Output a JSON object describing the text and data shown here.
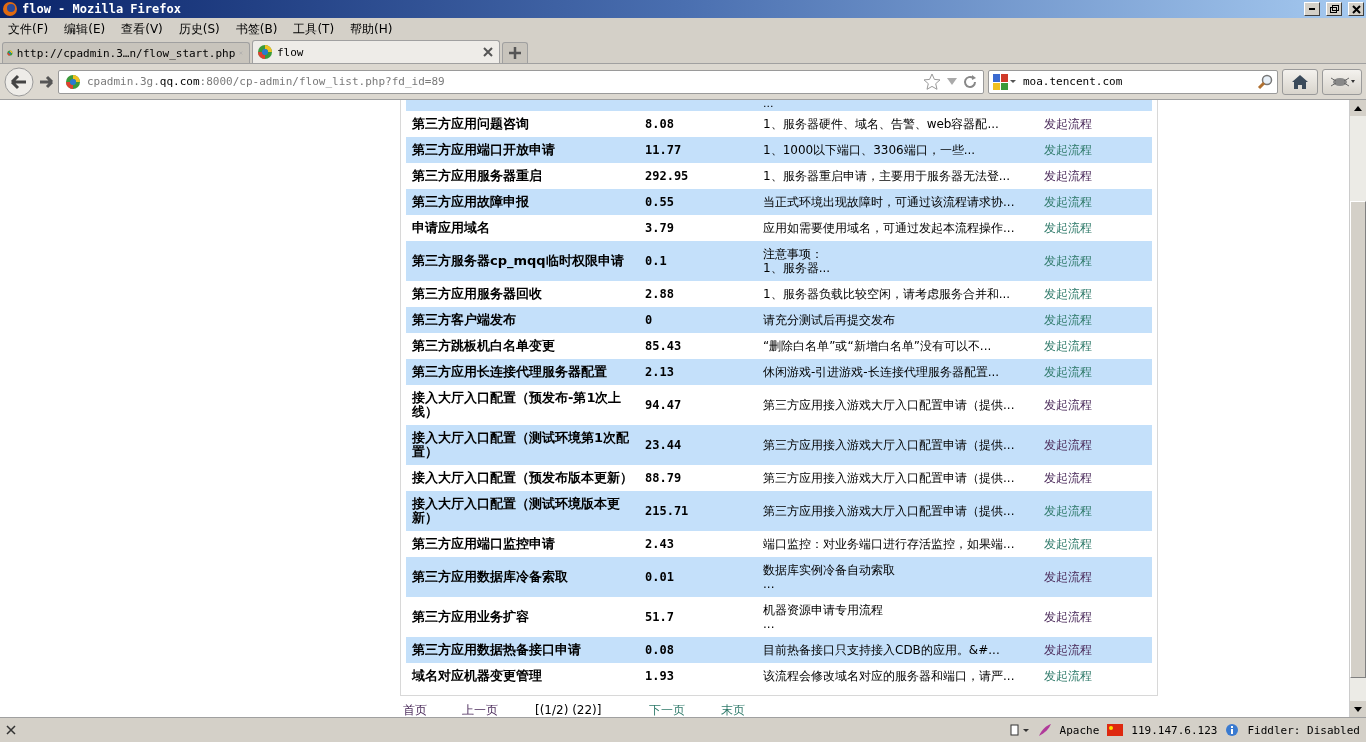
{
  "window": {
    "title": "flow - Mozilla Firefox"
  },
  "menu": [
    "文件(F)",
    "编辑(E)",
    "查看(V)",
    "历史(S)",
    "书签(B)",
    "工具(T)",
    "帮助(H)"
  ],
  "tabs": [
    {
      "label": "http://cpadmin.3…n/flow_start.php",
      "selected": false
    },
    {
      "label": "flow",
      "selected": true
    }
  ],
  "address_bar": {
    "value": "cpadmin.3g.**qq.com**:8000/cp-admin/flow_list.php?fd_id=89"
  },
  "search_field": {
    "value": "moa.tencent.com"
  },
  "table": {
    "cut_row": {
      "description": "..."
    },
    "rows": [
      {
        "name": "第三方应用问题咨询",
        "score": "8.08",
        "description": "1、服务器硬件、域名、告警、web容器配...",
        "action": "发起流程",
        "visited": true
      },
      {
        "name": "第三方应用端口开放申请",
        "score": "11.77",
        "description": "1、1000以下端口、3306端口，一些...",
        "action": "发起流程",
        "visited": false
      },
      {
        "name": "第三方应用服务器重启",
        "score": "292.95",
        "description": "1、服务器重启申请，主要用于服务器无法登...",
        "action": "发起流程",
        "visited": true
      },
      {
        "name": "第三方应用故障申报",
        "score": "0.55",
        "description": "当正式环境出现故障时，可通过该流程请求协...",
        "action": "发起流程",
        "visited": false
      },
      {
        "name": "申请应用域名",
        "score": "3.79",
        "description": "应用如需要使用域名，可通过发起本流程操作...",
        "action": "发起流程",
        "visited": false
      },
      {
        "name": "第三方服务器cp_mqq临时权限申请",
        "score": "0.1",
        "description": "注意事项：\n1、服务器...",
        "action": "发起流程",
        "visited": false
      },
      {
        "name": "第三方应用服务器回收",
        "score": "2.88",
        "description": "1、服务器负载比较空闲，请考虑服务合并和...",
        "action": "发起流程",
        "visited": false
      },
      {
        "name": "第三方客户端发布",
        "score": "0",
        "description": "请充分测试后再提交发布",
        "action": "发起流程",
        "visited": false
      },
      {
        "name": "第三方跳板机白名单变更",
        "score": "85.43",
        "description": "“删除白名单”或“新增白名单”没有可以不...",
        "action": "发起流程",
        "visited": false
      },
      {
        "name": "第三方应用长连接代理服务器配置",
        "score": "2.13",
        "description": "休闲游戏-引进游戏-长连接代理服务器配置...",
        "action": "发起流程",
        "visited": false
      },
      {
        "name": "接入大厅入口配置（预发布-第1次上线）",
        "score": "94.47",
        "description": "第三方应用接入游戏大厅入口配置申请（提供...",
        "action": "发起流程",
        "visited": true
      },
      {
        "name": "接入大厅入口配置（测试环境第1次配置）",
        "score": "23.44",
        "description": "第三方应用接入游戏大厅入口配置申请（提供...",
        "action": "发起流程",
        "visited": true
      },
      {
        "name": "接入大厅入口配置（预发布版本更新）",
        "score": "88.79",
        "description": "第三方应用接入游戏大厅入口配置申请（提供...",
        "action": "发起流程",
        "visited": true
      },
      {
        "name": "接入大厅入口配置（测试环境版本更新）",
        "score": "215.71",
        "description": "第三方应用接入游戏大厅入口配置申请（提供...",
        "action": "发起流程",
        "visited": false
      },
      {
        "name": "第三方应用端口监控申请",
        "score": "2.43",
        "description": "端口监控：对业务端口进行存活监控，如果端...",
        "action": "发起流程",
        "visited": false
      },
      {
        "name": "第三方应用数据库冷备索取",
        "score": "0.01",
        "description": "数据库实例冷备自动索取\n...",
        "action": "发起流程",
        "visited": true
      },
      {
        "name": "第三方应用业务扩容",
        "score": "51.7",
        "description": "机器资源申请专用流程\n...",
        "action": "发起流程",
        "visited": true
      },
      {
        "name": "第三方应用数据热备接口申请",
        "score": "0.08",
        "description": "目前热备接口只支持接入CDB的应用。&#...",
        "action": "发起流程",
        "visited": true
      },
      {
        "name": "域名对应机器变更管理",
        "score": "1.93",
        "description": "该流程会修改域名对应的服务器和端口，请严...",
        "action": "发起流程",
        "visited": false
      }
    ]
  },
  "pagination": [
    {
      "label": "首页",
      "kind": "link",
      "visited": true
    },
    {
      "label": "上一页",
      "kind": "link",
      "visited": true
    },
    {
      "label": "[(1/2) (22)]",
      "kind": "text"
    },
    {
      "label": "下一页",
      "kind": "link",
      "visited": false
    },
    {
      "label": "末页",
      "kind": "link",
      "visited": false
    }
  ],
  "status_bar": {
    "items": [
      "Apache",
      "119.147.6.123",
      "Fiddler: Disabled"
    ]
  }
}
